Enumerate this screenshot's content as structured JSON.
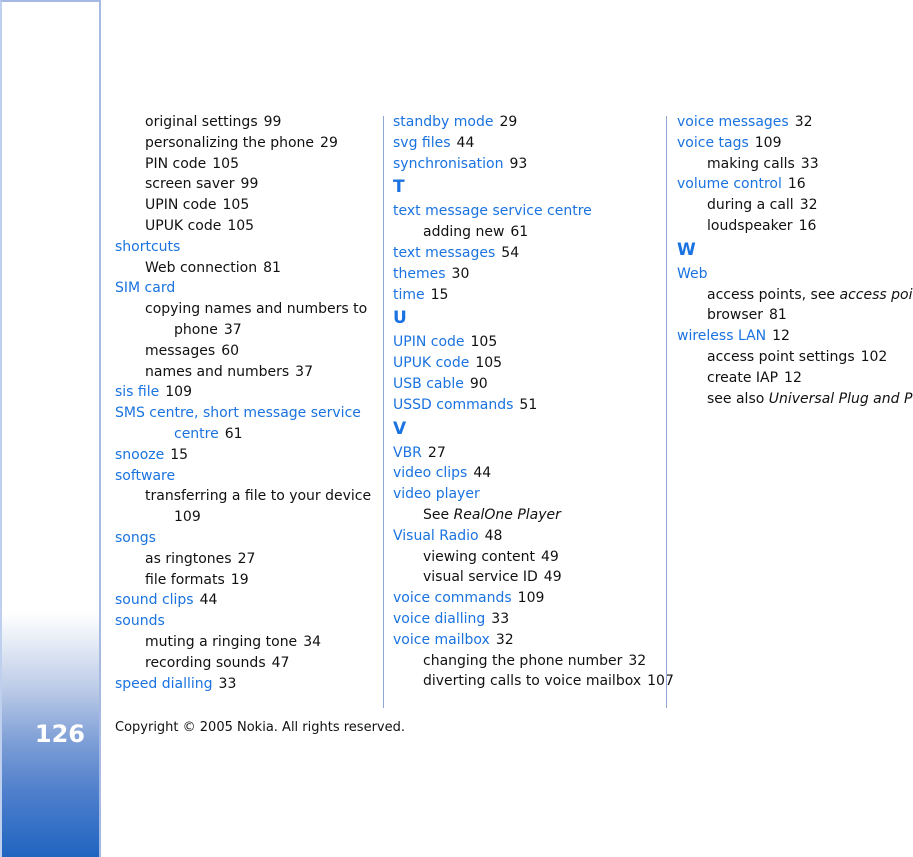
{
  "page_number": "126",
  "copyright": "Copyright © 2005 Nokia. All rights reserved.",
  "columns": [
    [
      {
        "type": "sub",
        "text": "original settings",
        "page": "99"
      },
      {
        "type": "sub",
        "text": "personalizing the phone",
        "page": "29"
      },
      {
        "type": "sub",
        "text": "PIN code",
        "page": "105"
      },
      {
        "type": "sub",
        "text": "screen saver",
        "page": "99"
      },
      {
        "type": "sub",
        "text": "UPIN code",
        "page": "105"
      },
      {
        "type": "sub",
        "text": "UPUK code",
        "page": "105"
      },
      {
        "type": "main",
        "text": "shortcuts",
        "page": ""
      },
      {
        "type": "sub",
        "text": "Web connection",
        "page": "81"
      },
      {
        "type": "main",
        "text": "SIM card",
        "page": ""
      },
      {
        "type": "sub",
        "text": "copying names and numbers to",
        "page": ""
      },
      {
        "type": "cont",
        "text": "phone",
        "page": "37"
      },
      {
        "type": "sub",
        "text": "messages",
        "page": "60"
      },
      {
        "type": "sub",
        "text": "names and numbers",
        "page": "37"
      },
      {
        "type": "main",
        "text": "sis file",
        "page": "109"
      },
      {
        "type": "main",
        "text": "SMS centre, short message service",
        "page": ""
      },
      {
        "type": "maincont",
        "text": "centre",
        "page": "61"
      },
      {
        "type": "main",
        "text": "snooze",
        "page": "15"
      },
      {
        "type": "main",
        "text": "software",
        "page": ""
      },
      {
        "type": "sub",
        "text": "transferring a file to your device",
        "page": ""
      },
      {
        "type": "cont",
        "text": "",
        "page": "109"
      },
      {
        "type": "main",
        "text": "songs",
        "page": ""
      },
      {
        "type": "sub",
        "text": "as ringtones",
        "page": "27"
      },
      {
        "type": "sub",
        "text": "file formats",
        "page": "19"
      },
      {
        "type": "main",
        "text": "sound clips",
        "page": "44"
      },
      {
        "type": "main",
        "text": "sounds",
        "page": ""
      },
      {
        "type": "sub",
        "text": "muting a ringing tone",
        "page": "34"
      },
      {
        "type": "sub",
        "text": "recording sounds",
        "page": "47"
      },
      {
        "type": "main",
        "text": "speed dialling",
        "page": "33"
      }
    ],
    [
      {
        "type": "main",
        "text": "standby mode",
        "page": "29"
      },
      {
        "type": "main",
        "text": "svg files",
        "page": "44"
      },
      {
        "type": "main",
        "text": "synchronisation",
        "page": "93"
      },
      {
        "type": "letter",
        "text": "T"
      },
      {
        "type": "main",
        "text": "text message service centre",
        "page": ""
      },
      {
        "type": "sub",
        "text": "adding new",
        "page": "61"
      },
      {
        "type": "main",
        "text": "text messages",
        "page": "54"
      },
      {
        "type": "main",
        "text": "themes",
        "page": "30"
      },
      {
        "type": "main",
        "text": "time",
        "page": "15"
      },
      {
        "type": "letter",
        "text": "U"
      },
      {
        "type": "main",
        "text": "UPIN code",
        "page": "105"
      },
      {
        "type": "main",
        "text": "UPUK code",
        "page": "105"
      },
      {
        "type": "main",
        "text": "USB cable",
        "page": "90"
      },
      {
        "type": "main",
        "text": "USSD commands",
        "page": "51"
      },
      {
        "type": "letter",
        "text": "V"
      },
      {
        "type": "main",
        "text": "VBR",
        "page": "27"
      },
      {
        "type": "main",
        "text": "video clips",
        "page": "44"
      },
      {
        "type": "main",
        "text": "video player",
        "page": ""
      },
      {
        "type": "sub",
        "text": "See ",
        "italic": "RealOne Player",
        "page": ""
      },
      {
        "type": "main",
        "text": "Visual Radio",
        "page": "48"
      },
      {
        "type": "sub",
        "text": "viewing content",
        "page": "49"
      },
      {
        "type": "sub",
        "text": "visual service ID",
        "page": "49"
      },
      {
        "type": "main",
        "text": "voice commands",
        "page": "109"
      },
      {
        "type": "main",
        "text": "voice dialling",
        "page": "33"
      },
      {
        "type": "main",
        "text": "voice mailbox",
        "page": "32"
      },
      {
        "type": "sub",
        "text": "changing the phone number",
        "page": "32"
      },
      {
        "type": "sub",
        "text": "diverting calls to voice mailbox",
        "page": "107"
      }
    ],
    [
      {
        "type": "main",
        "text": "voice messages",
        "page": "32"
      },
      {
        "type": "main",
        "text": "voice tags",
        "page": "109"
      },
      {
        "type": "sub",
        "text": "making calls",
        "page": "33"
      },
      {
        "type": "main",
        "text": "volume control",
        "page": "16"
      },
      {
        "type": "sub",
        "text": "during a call",
        "page": "32"
      },
      {
        "type": "sub",
        "text": "loudspeaker",
        "page": "16"
      },
      {
        "type": "letter",
        "text": "W"
      },
      {
        "type": "main",
        "text": "Web",
        "page": ""
      },
      {
        "type": "sub",
        "text": "access points, see ",
        "italic": "access points",
        "page": ""
      },
      {
        "type": "sub",
        "text": "browser",
        "page": "81"
      },
      {
        "type": "main",
        "text": "wireless LAN",
        "page": "12"
      },
      {
        "type": "sub",
        "text": "access point settings",
        "page": "102"
      },
      {
        "type": "sub",
        "text": "create IAP",
        "page": "12"
      },
      {
        "type": "sub",
        "text": "see also ",
        "italic": "Universal Plug and Play",
        "page": ""
      }
    ]
  ]
}
